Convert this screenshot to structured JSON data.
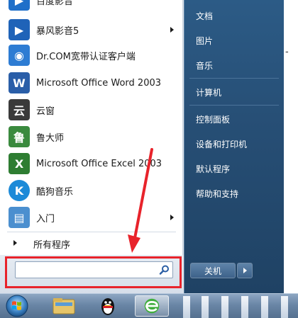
{
  "programs": [
    {
      "label": "百度影音",
      "icon": "baidu-player-icon",
      "color": "#1f6fc9",
      "glyph": "▶",
      "has_submenu": false
    },
    {
      "label": "暴风影音5",
      "icon": "baofeng-player-icon",
      "color": "#1f63b8",
      "glyph": "▶",
      "has_submenu": true
    },
    {
      "label": "Dr.COM宽带认证客户端",
      "icon": "drcom-client-icon",
      "color": "#2d7cd3",
      "glyph": "◉",
      "has_submenu": false
    },
    {
      "label": "Microsoft Office Word 2003",
      "icon": "word-icon",
      "color": "#2a5ea8",
      "glyph": "W",
      "has_submenu": false
    },
    {
      "label": "云窗",
      "icon": "yunchuang-icon",
      "color": "#3a3a3a",
      "glyph": "云",
      "has_submenu": false
    },
    {
      "label": "鲁大师",
      "icon": "ludashi-icon",
      "color": "#3a8a3e",
      "glyph": "鲁",
      "has_submenu": false
    },
    {
      "label": "Microsoft Office Excel 2003",
      "icon": "excel-icon",
      "color": "#2e7d32",
      "glyph": "X",
      "has_submenu": false
    },
    {
      "label": "酷狗音乐",
      "icon": "kugou-music-icon",
      "color": "#1c8ad8",
      "glyph": "K",
      "has_submenu": false
    },
    {
      "label": "入门",
      "icon": "getting-started-icon",
      "color": "#4b8fcf",
      "glyph": "▤",
      "has_submenu": true
    }
  ],
  "all_programs_label": "所有程序",
  "search": {
    "placeholder": "",
    "value": ""
  },
  "right_items_group1": [
    "文档",
    "图片",
    "音乐"
  ],
  "right_items_group2": [
    "计算机"
  ],
  "right_items_group3": [
    "控制面板",
    "设备和打印机",
    "默认程序",
    "帮助和支持"
  ],
  "shutdown_label": "关机",
  "background_text": [
    "-"
  ]
}
